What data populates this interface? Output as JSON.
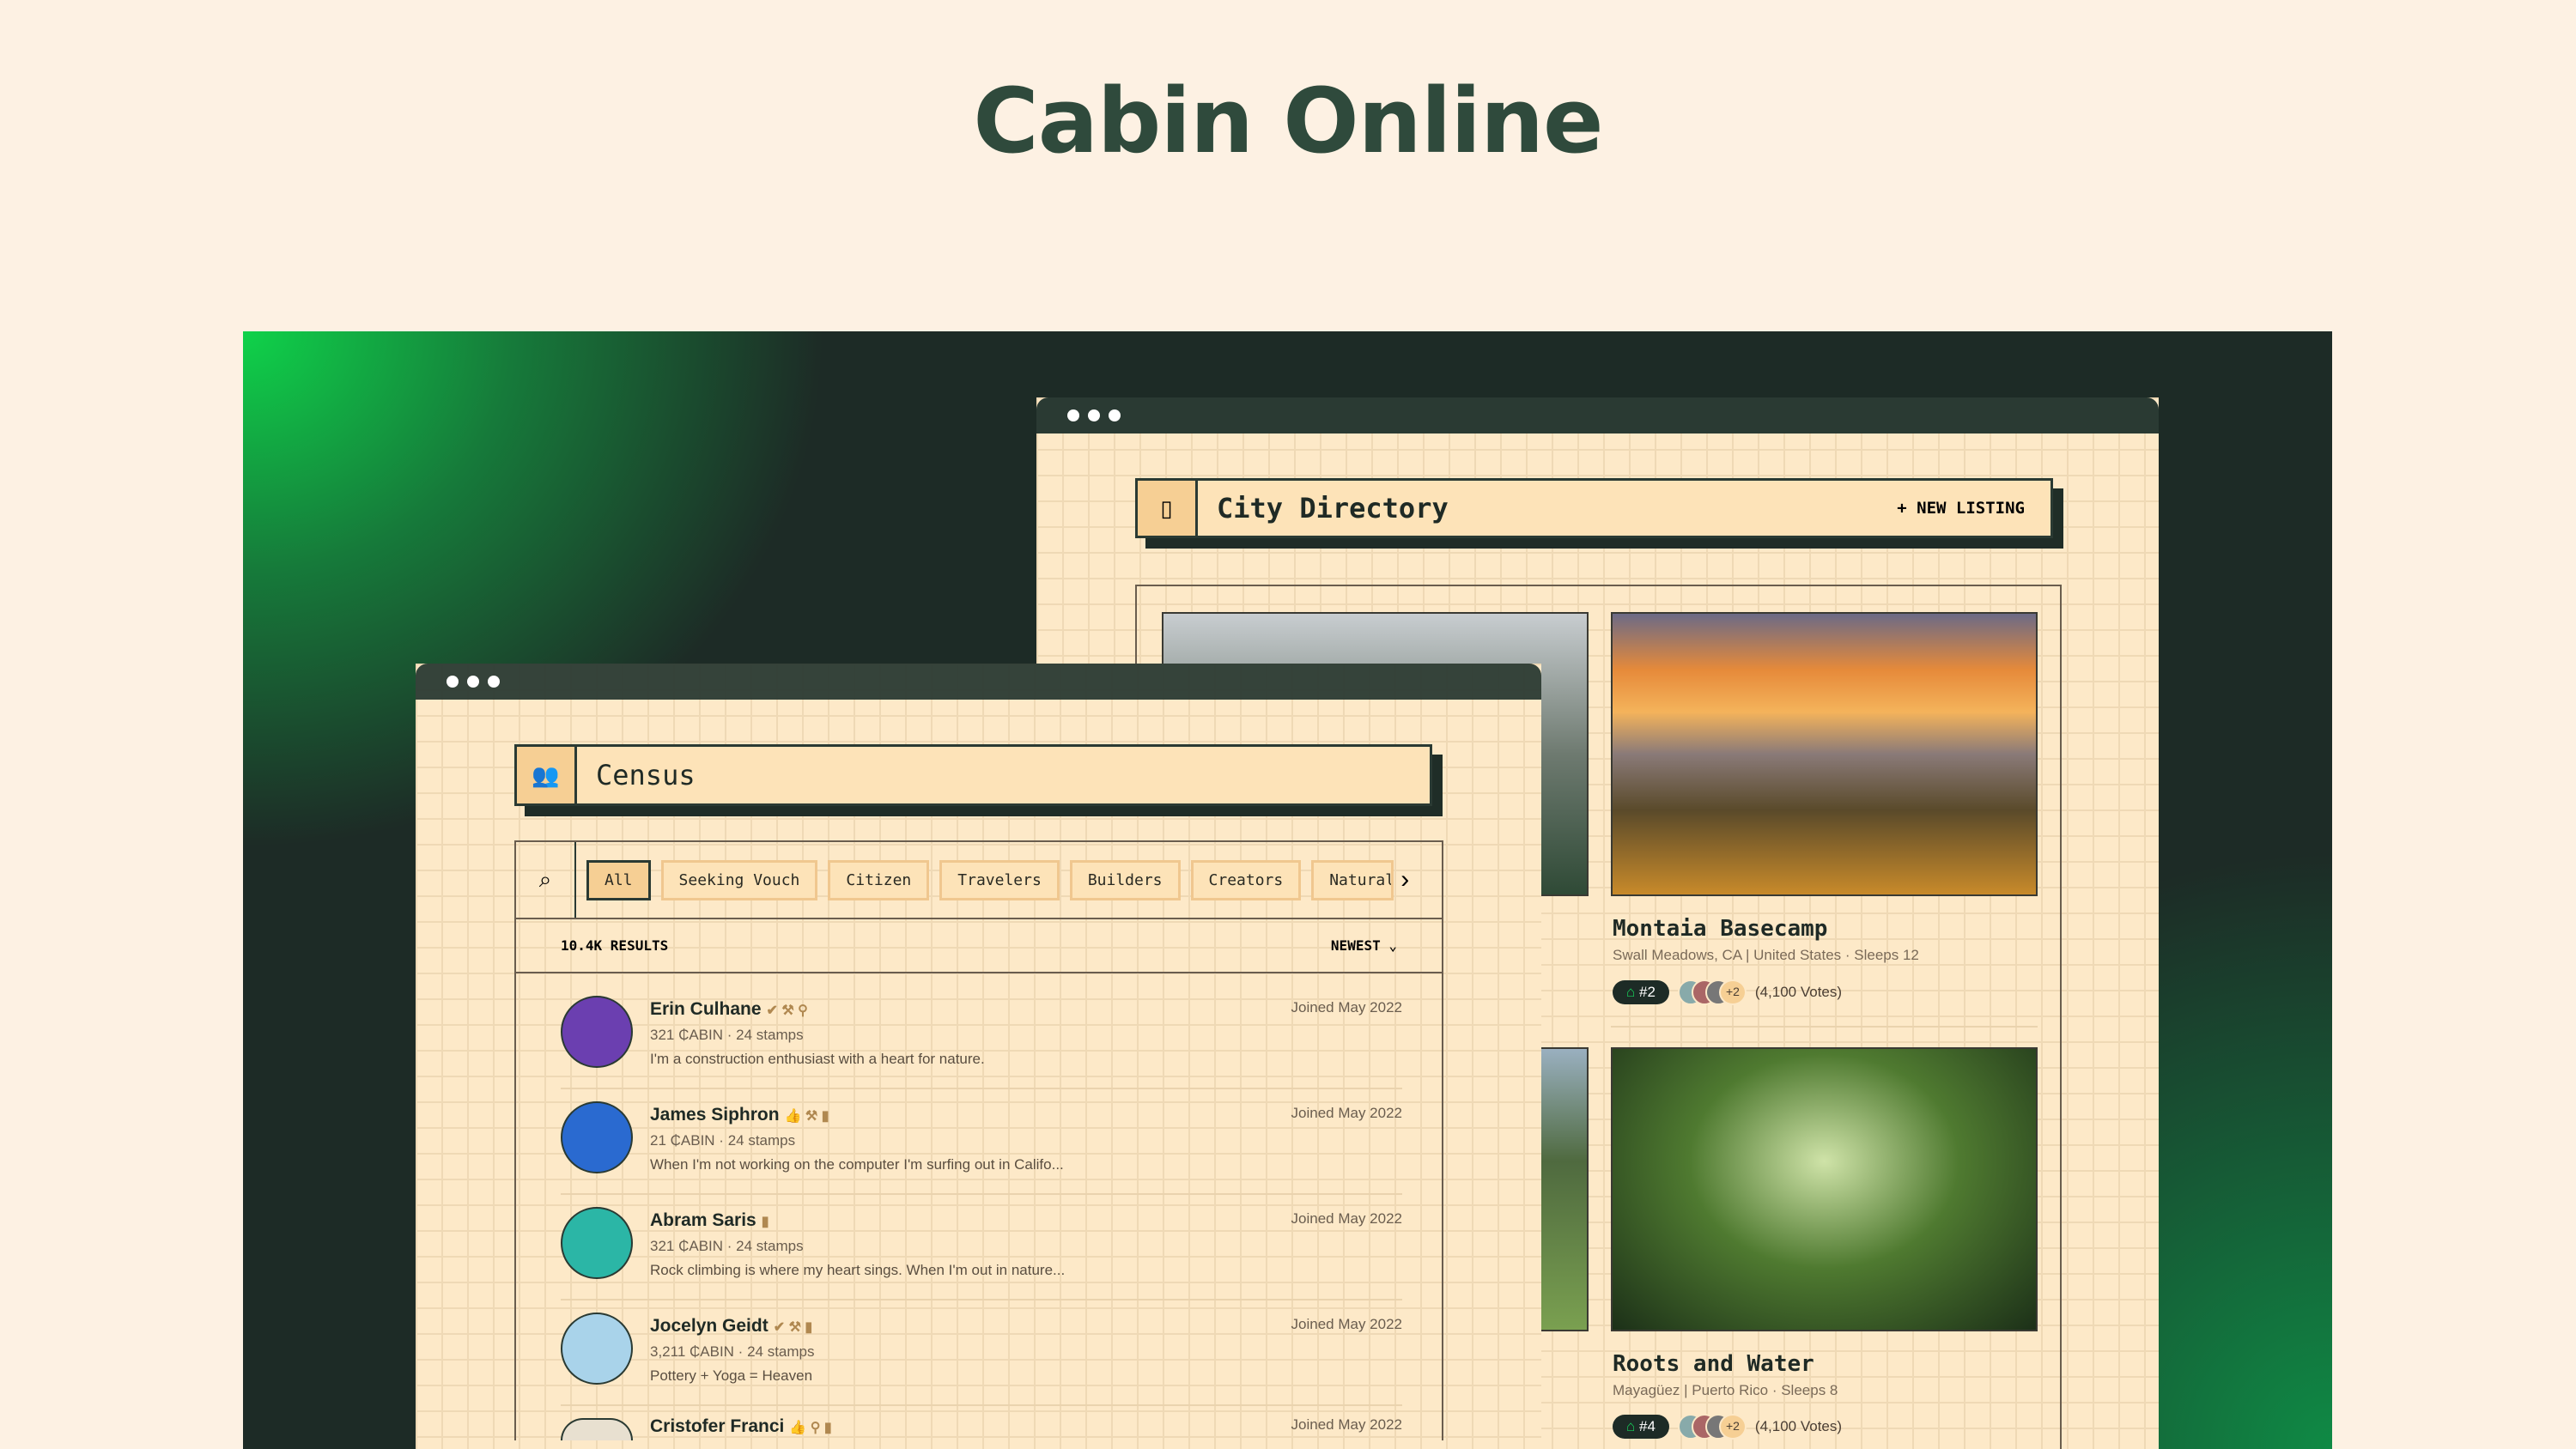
{
  "page": {
    "title": "Cabin Online"
  },
  "directory": {
    "title": "City Directory",
    "new_listing": "+ NEW LISTING",
    "listings": [
      {
        "name": "Montaia Basecamp",
        "location": "Swall Meadows, CA | United States · Sleeps 12",
        "rank": "#2",
        "extra": "+2",
        "votes": "(4,100 Votes)"
      },
      {
        "name": "Roots and Water",
        "location": "Mayagüez | Puerto Rico · Sleeps 8",
        "rank": "#4",
        "extra": "+2",
        "votes": "(4,100 Votes)"
      }
    ]
  },
  "census": {
    "title": "Census",
    "filters": [
      "All",
      "Seeking Vouch",
      "Citizen",
      "Travelers",
      "Builders",
      "Creators",
      "Natural"
    ],
    "results": "10.4K RESULTS",
    "sort": "NEWEST",
    "members": [
      {
        "name": "Erin Culhane",
        "stats": "321 ₵ABIN · 24 stamps",
        "bio": "I'm a construction enthusiast with a heart for nature.",
        "joined": "Joined May 2022",
        "badges": "✔ ⚒ ⚲",
        "color": "#6b3fb0"
      },
      {
        "name": "James Siphron",
        "stats": "21 ₵ABIN · 24 stamps",
        "bio": "When I'm not working on the computer I'm surfing out in Califo...",
        "joined": "Joined May 2022",
        "badges": "👍 ⚒ ▮",
        "color": "#2a6ad0"
      },
      {
        "name": "Abram Saris",
        "stats": "321 ₵ABIN · 24 stamps",
        "bio": "Rock climbing is where my heart sings. When I'm out in nature...",
        "joined": "Joined May 2022",
        "badges": "▮",
        "color": "#2bb6a6"
      },
      {
        "name": "Jocelyn Geidt",
        "stats": "3,211 ₵ABIN · 24 stamps",
        "bio": "Pottery + Yoga = Heaven",
        "joined": "Joined May 2022",
        "badges": "✔ ⚒ ▮",
        "color": "#a9d3ea"
      },
      {
        "name": "Cristofer Franci",
        "stats": "",
        "bio": "",
        "joined": "Joined May 2022",
        "badges": "👍 ⚲ ▮",
        "color": "#e8e0d0"
      }
    ]
  }
}
